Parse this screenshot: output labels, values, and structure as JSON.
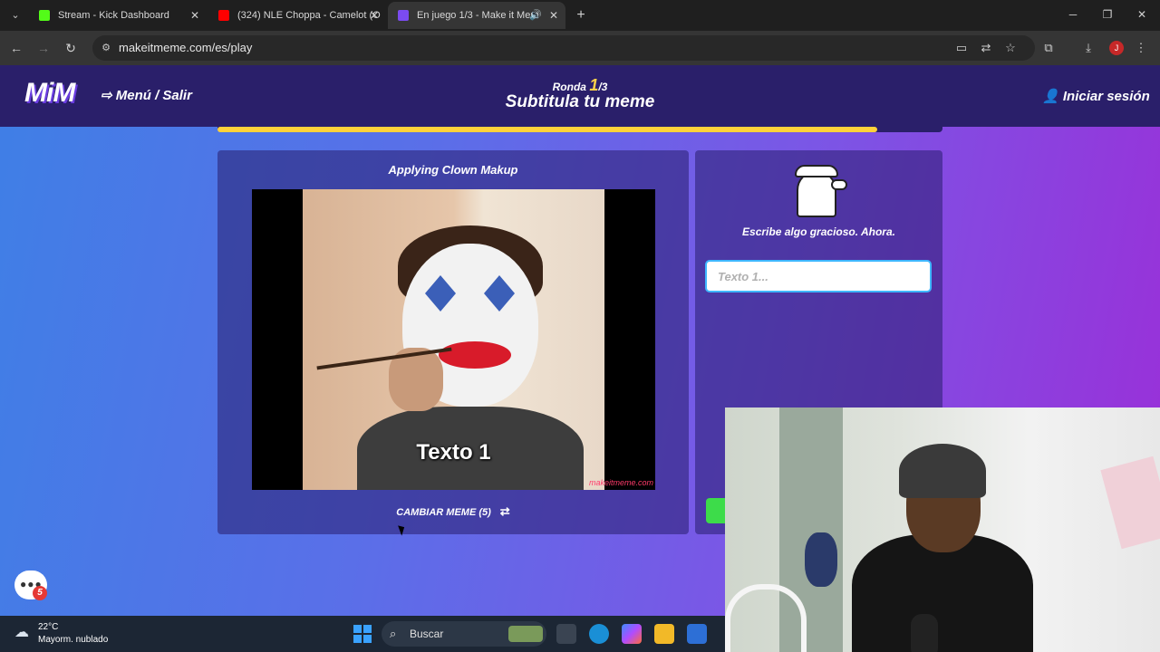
{
  "browser": {
    "tabs": [
      {
        "title": "Stream - Kick Dashboard",
        "favicon_color": "#53fc18"
      },
      {
        "title": "(324) NLE Choppa - Camelot (O",
        "favicon_color": "#ff0000"
      },
      {
        "title": "En juego 1/3 - Make it Mem",
        "favicon_color": "#7b4bf0",
        "favicon_text": "MiM"
      }
    ],
    "url": "makeitmeme.com/es/play",
    "profile_initial": "J"
  },
  "site": {
    "logo": "MiM",
    "menu_label": "Menú / Salir",
    "round_label": "Ronda",
    "round_current": "1",
    "round_total": "/3",
    "title": "Subtitula tu meme",
    "login_label": "Iniciar sesión",
    "progress": 0.91
  },
  "meme": {
    "title": "Applying Clown Makup",
    "caption": "Texto 1",
    "watermark": "makeitmeme.com",
    "change_label": "CAMBIAR MEME (5)"
  },
  "editor": {
    "prompt": "Escribe algo gracioso. Ahora.",
    "input_placeholder": "Texto 1...",
    "input_value": ""
  },
  "chat": {
    "badge_count": "5"
  },
  "taskbar": {
    "temperature": "22°C",
    "weather": "Mayorm. nublado",
    "search_label": "Buscar"
  },
  "colors": {
    "header_bg": "#2a1f6a",
    "progress": "#ffd23a",
    "input_border": "#3fb7ff",
    "accent_green": "#3ddc4a"
  }
}
